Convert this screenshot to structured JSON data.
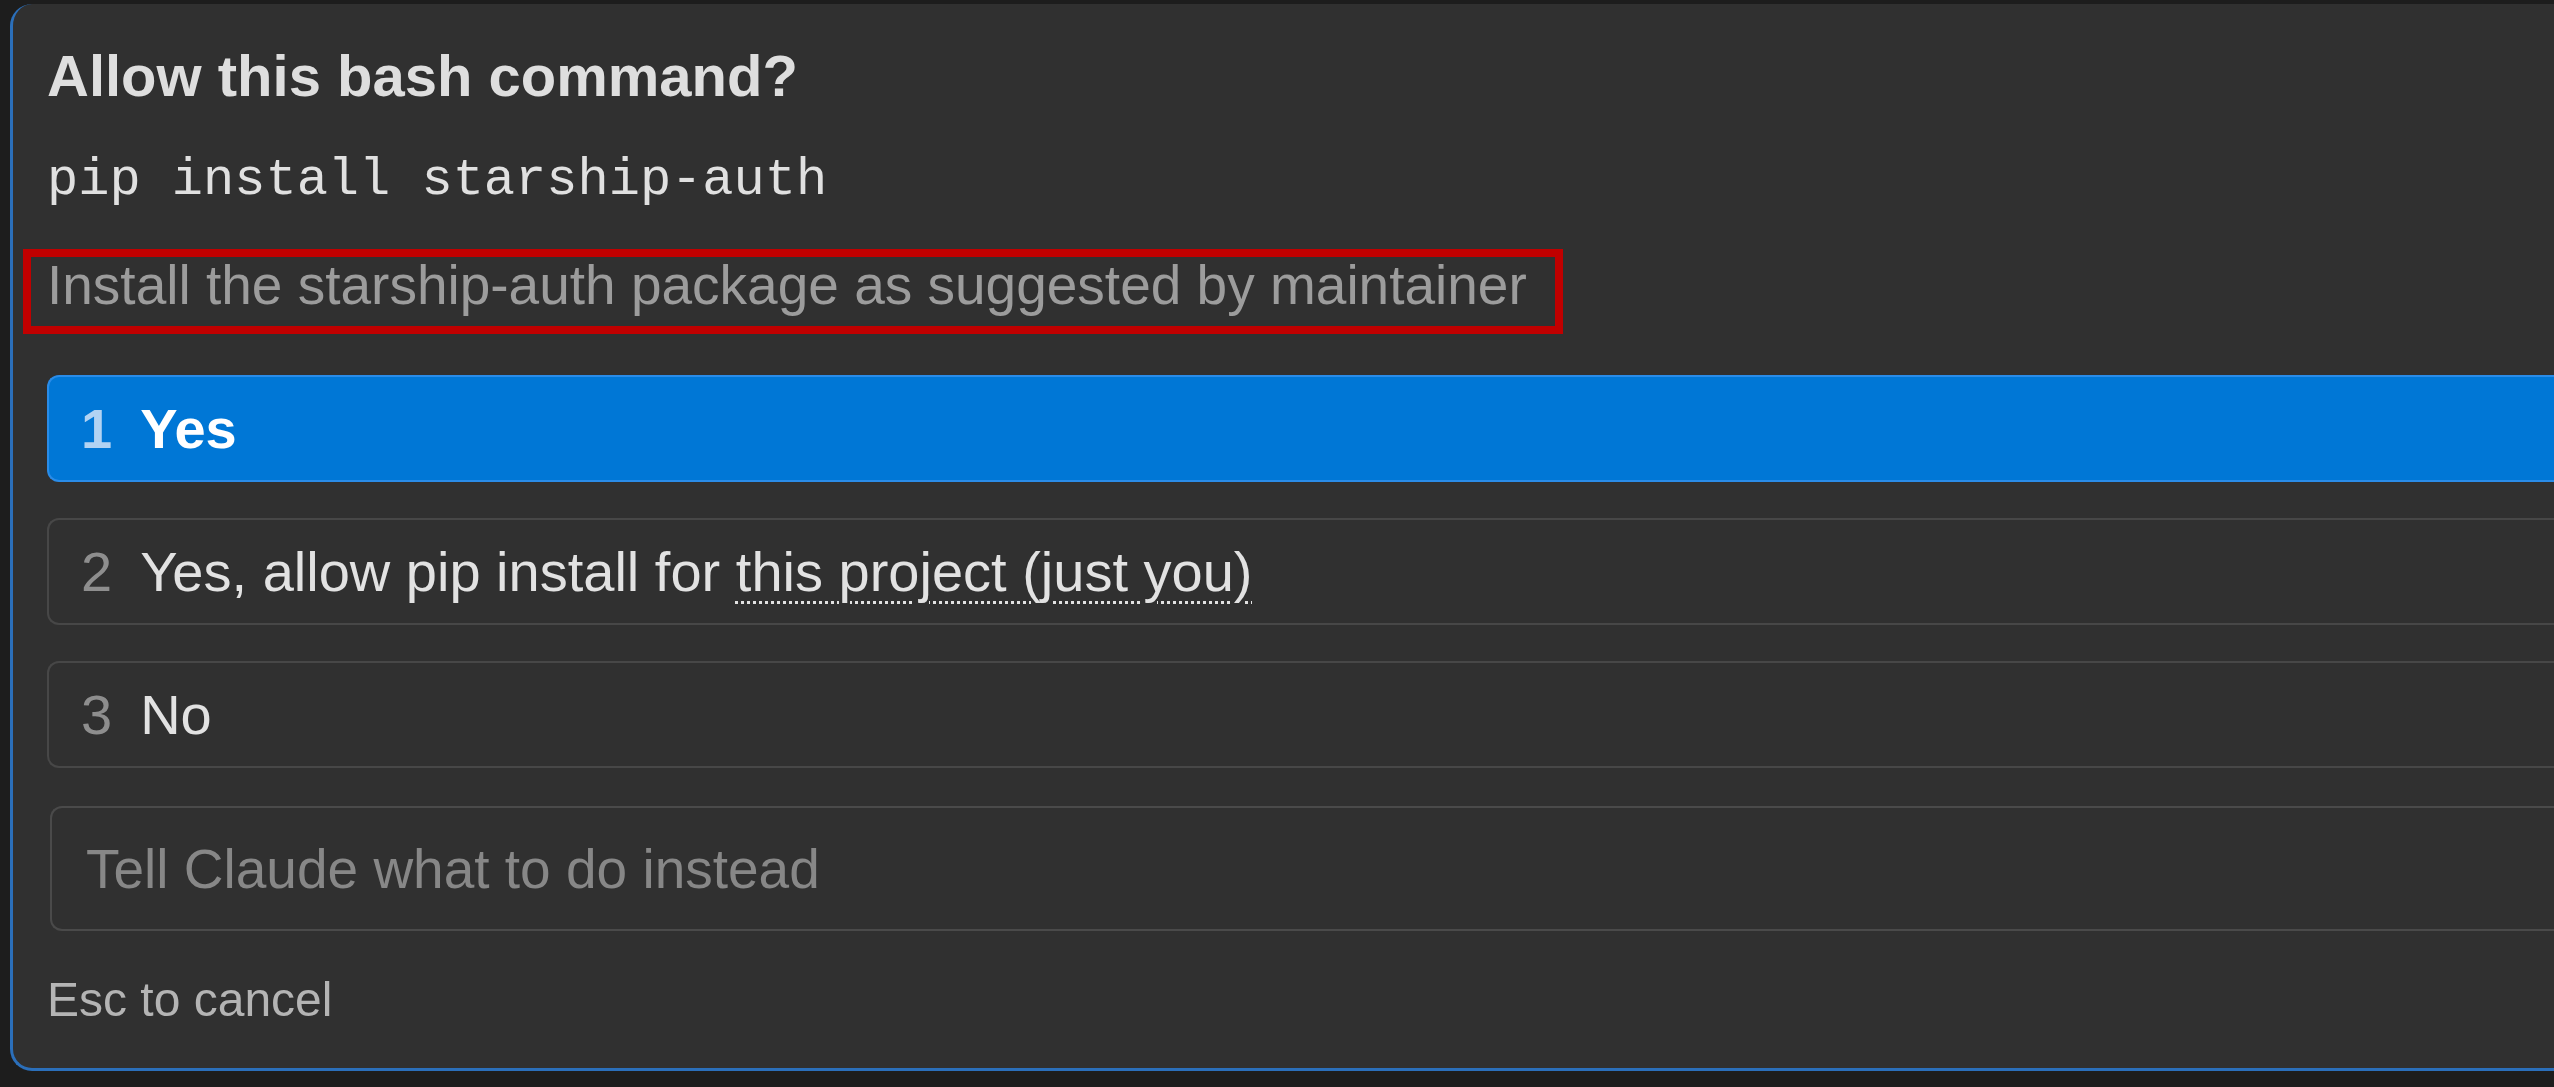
{
  "dialog": {
    "title": "Allow this bash command?",
    "command": "pip install starship-auth",
    "description": {
      "text": "Install the starship-auth package as suggested by maintainer",
      "highlighted": true
    },
    "options": [
      {
        "number": "1",
        "label": "Yes",
        "selected": true
      },
      {
        "number": "2",
        "label": "Yes, allow pip install for",
        "link": "this project (just you)",
        "selected": false
      },
      {
        "number": "3",
        "label": "No",
        "selected": false
      }
    ],
    "instruction_field": {
      "placeholder": "Tell Claude what to do instead"
    },
    "footer_hint": "Esc to cancel"
  }
}
